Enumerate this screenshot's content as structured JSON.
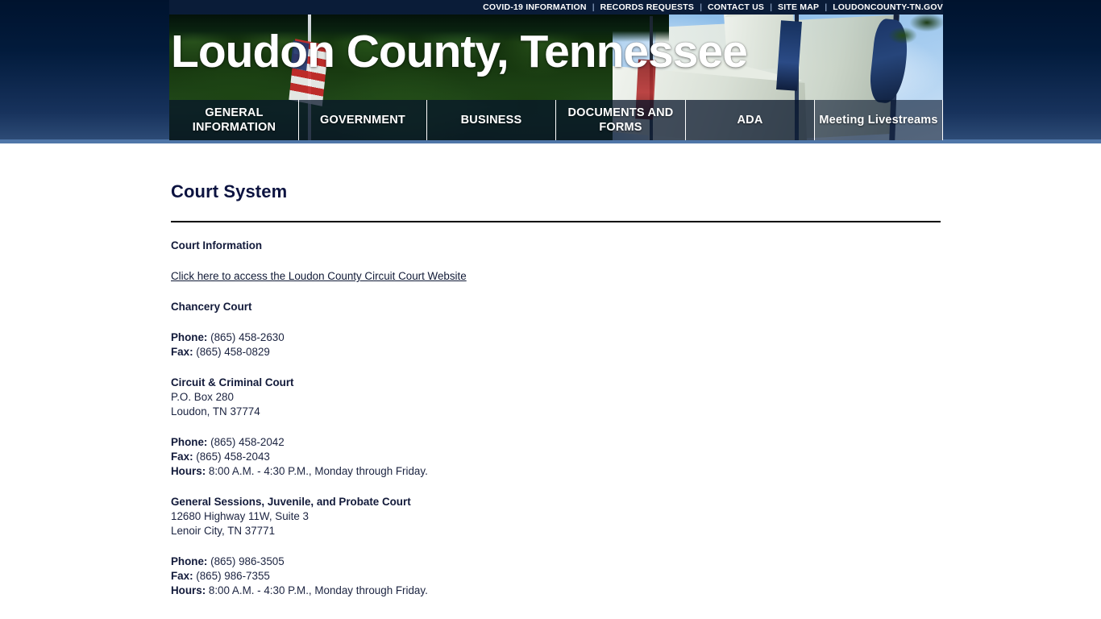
{
  "utility_bar": {
    "links": [
      "COVID-19 INFORMATION",
      "RECORDS REQUESTS",
      "CONTACT US",
      "SITE MAP",
      "LOUDONCOUNTY-TN.GOV"
    ],
    "separator": "|"
  },
  "banner": {
    "title": "Loudon County, Tennessee"
  },
  "main_nav": {
    "items": [
      {
        "label": "GENERAL INFORMATION"
      },
      {
        "label": "GOVERNMENT"
      },
      {
        "label": "BUSINESS"
      },
      {
        "label": "DOCUMENTS AND FORMS"
      },
      {
        "label": "ADA"
      },
      {
        "label": "Meeting Livestreams"
      }
    ]
  },
  "page": {
    "title": "Court System",
    "section_heading": "Court Information",
    "website_link": "Click here to access the Loudon County Circuit Court Website",
    "courts": [
      {
        "name": "Chancery Court",
        "address_lines": [],
        "details": [
          {
            "label": "Phone:",
            "value": "(865) 458-2630"
          },
          {
            "label": "Fax:",
            "value": "(865) 458-0829"
          }
        ]
      },
      {
        "name": "Circuit & Criminal Court",
        "address_lines": [
          "P.O. Box 280",
          "Loudon, TN 37774"
        ],
        "details": [
          {
            "label": "Phone:",
            "value": "(865) 458-2042"
          },
          {
            "label": "Fax:",
            "value": "(865) 458-2043"
          },
          {
            "label": "Hours:",
            "value": "8:00 A.M. - 4:30 P.M., Monday through Friday."
          }
        ]
      },
      {
        "name": "General Sessions, Juvenile, and Probate Court",
        "address_lines": [
          "12680 Highway 11W, Suite 3",
          "Lenoir City, TN 37771"
        ],
        "details": [
          {
            "label": "Phone:",
            "value": "(865) 986-3505"
          },
          {
            "label": "Fax:",
            "value": "(865) 986-7355"
          },
          {
            "label": "Hours:",
            "value": "8:00 A.M. - 4:30 P.M., Monday through Friday."
          }
        ]
      }
    ]
  },
  "colors": {
    "header_dark": "#00132e",
    "divider_blue": "#4f76a8",
    "title_navy": "#0c1340",
    "nav_overlay": "rgba(7,20,42,.74)"
  }
}
